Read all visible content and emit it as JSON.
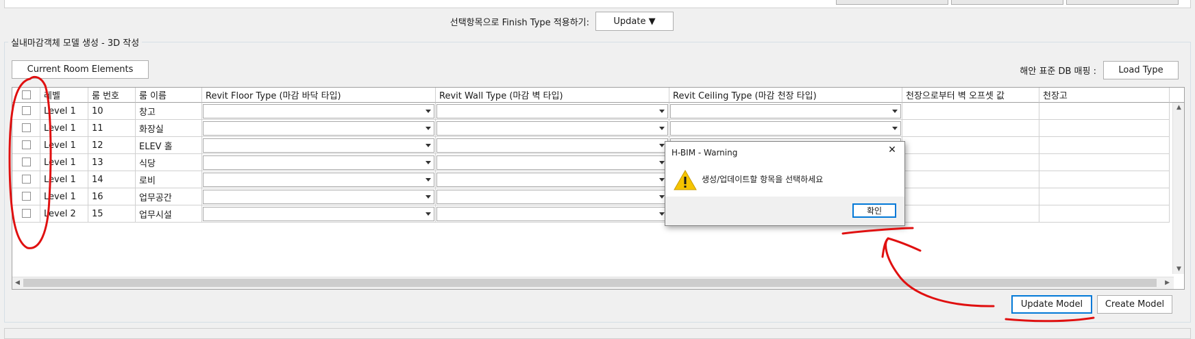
{
  "finish_type": {
    "label": "선택항목으로 Finish Type 적용하기:",
    "dropdown_value": "Update ▼"
  },
  "group": {
    "legend": "실내마감객체 모델 생성 - 3D 작성"
  },
  "toolbar": {
    "current_room_label": "Current Room Elements",
    "db_mapping_label": "해안 표준 DB 매핑 :",
    "load_type_label": "Load Type"
  },
  "grid": {
    "headers": [
      "",
      "레벨",
      "룸 번호",
      "룸 이름",
      "Revit Floor Type (마감 바닥 타입)",
      "Revit Wall Type (마감 벽 타입)",
      "Revit Ceiling Type (마감 천장 타입)",
      "천장으로부터 벽 오프셋 값",
      "천장고"
    ],
    "rows": [
      {
        "level": "Level 1",
        "number": "10",
        "name": "창고"
      },
      {
        "level": "Level 1",
        "number": "11",
        "name": "화장실"
      },
      {
        "level": "Level 1",
        "number": "12",
        "name": "ELEV 홀"
      },
      {
        "level": "Level 1",
        "number": "13",
        "name": "식당"
      },
      {
        "level": "Level 1",
        "number": "14",
        "name": "로비"
      },
      {
        "level": "Level 1",
        "number": "16",
        "name": "업무공간"
      },
      {
        "level": "Level 2",
        "number": "15",
        "name": "업무시설"
      }
    ]
  },
  "actions": {
    "update_model_label": "Update Model",
    "create_model_label": "Create Model"
  },
  "dialog": {
    "title": "H-BIM - Warning",
    "message": "생성/업데이트할 항목을 선택하세요",
    "ok_label": "확인",
    "close_glyph": "✕",
    "icon": "warning-icon"
  },
  "colors": {
    "annotation_red": "#e01010",
    "focus_blue": "#0078d7",
    "warning_yellow": "#f5c400"
  }
}
